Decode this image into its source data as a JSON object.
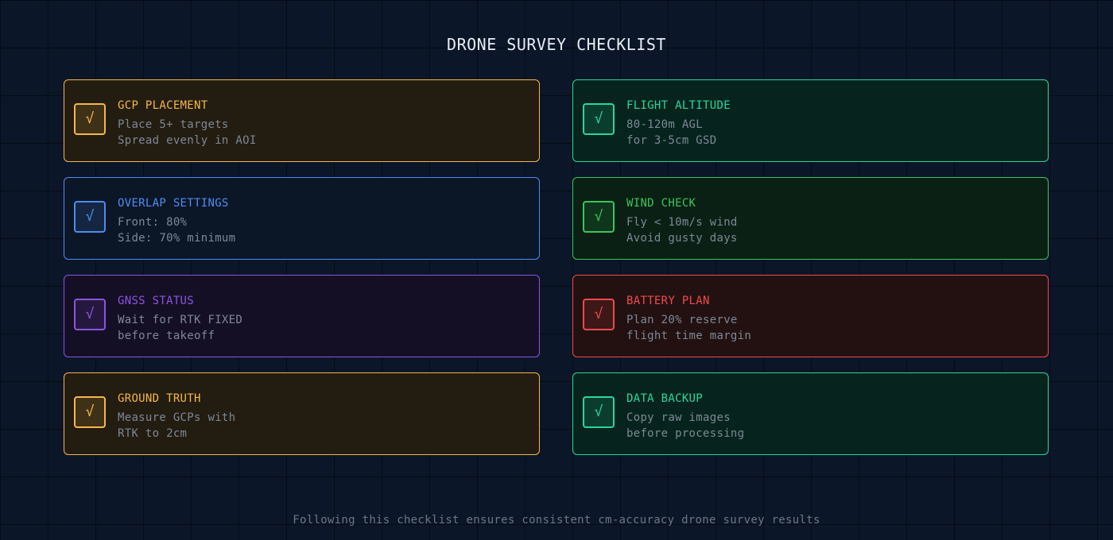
{
  "title": "DRONE SURVEY CHECKLIST",
  "check_glyph": "√",
  "cards": [
    {
      "title": "GCP PLACEMENT",
      "line1": "Place 5+ targets",
      "line2": "Spread evenly in AOI",
      "accent": "#f5b849",
      "bg": "#231c11"
    },
    {
      "title": "FLIGHT ALTITUDE",
      "line1": "80-120m AGL",
      "line2": "for 3-5cm GSD",
      "accent": "#2bd69a",
      "bg": "#06241d"
    },
    {
      "title": "OVERLAP SETTINGS",
      "line1": "Front: 80%",
      "line2": "Side: 70% minimum",
      "accent": "#4f8df0",
      "bg": "#0b1627"
    },
    {
      "title": "WIND CHECK",
      "line1": "Fly < 10m/s wind",
      "line2": "Avoid gusty days",
      "accent": "#3cc55a",
      "bg": "#0a2014"
    },
    {
      "title": "GNSS STATUS",
      "line1": "Wait for RTK FIXED",
      "line2": "before takeoff",
      "accent": "#8b55e0",
      "bg": "#150f25"
    },
    {
      "title": "BATTERY PLAN",
      "line1": "Plan 20% reserve",
      "line2": "flight time margin",
      "accent": "#ef4b4b",
      "bg": "#231111"
    },
    {
      "title": "GROUND TRUTH",
      "line1": "Measure GCPs with",
      "line2": "RTK to 2cm",
      "accent": "#f5b849",
      "bg": "#231c11"
    },
    {
      "title": "DATA BACKUP",
      "line1": "Copy raw images",
      "line2": "before processing",
      "accent": "#2bd69a",
      "bg": "#06241d"
    }
  ],
  "footer": "Following this checklist ensures consistent cm-accuracy drone survey results"
}
